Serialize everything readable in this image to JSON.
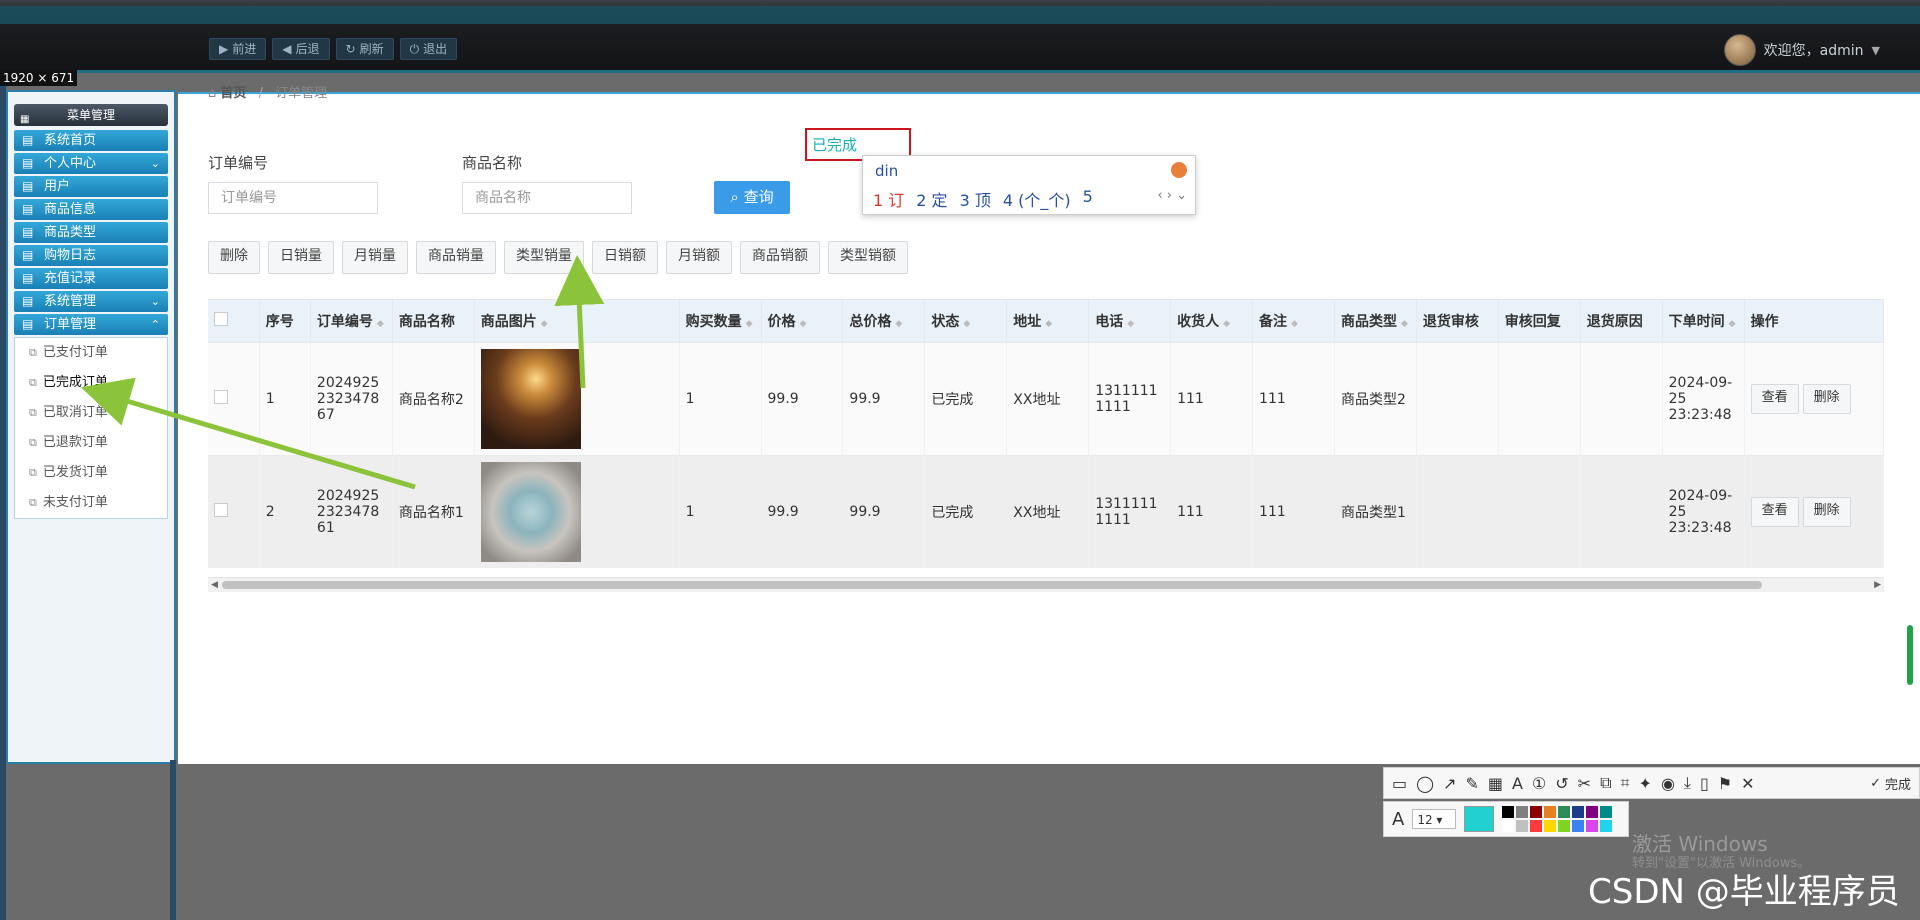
{
  "topbar": {
    "nav": [
      "前进",
      "后退",
      "刷新",
      "退出"
    ],
    "welcome": "欢迎您，admin"
  },
  "dim_label": "1920 × 671",
  "sidebar": {
    "header": "菜单管理",
    "items": [
      "系统首页",
      "个人中心",
      "用户",
      "商品信息",
      "商品类型",
      "购物日志",
      "充值记录",
      "系统管理",
      "订单管理"
    ],
    "sub_items": [
      "已支付订单",
      "已完成订单",
      "已取消订单",
      "已退款订单",
      "已发货订单",
      "未支付订单"
    ],
    "active_sub": "已完成订单"
  },
  "breadcrumb": {
    "home": "首页",
    "current": "订单管理"
  },
  "search": {
    "order_label": "订单编号",
    "order_placeholder": "订单编号",
    "product_label": "商品名称",
    "product_placeholder": "商品名称",
    "query_button": "查询"
  },
  "toolbar": [
    "删除",
    "日销量",
    "月销量",
    "商品销量",
    "类型销量",
    "日销额",
    "月销额",
    "商品销额",
    "类型销额"
  ],
  "highlight_text": "已完成",
  "ime": {
    "input": "din",
    "candidates": [
      "1 订",
      "2 定",
      "3 顶",
      "4 (个_个)",
      "5"
    ]
  },
  "table": {
    "headers": [
      "序号",
      "订单编号",
      "商品名称",
      "商品图片",
      "购买数量",
      "价格",
      "总价格",
      "状态",
      "地址",
      "电话",
      "收货人",
      "备注",
      "商品类型",
      "退货审核",
      "审核回复",
      "退货原因",
      "下单时间",
      "操作"
    ],
    "rows": [
      {
        "idx": "1",
        "order_no": "2024925232347867",
        "name": "商品名称2",
        "image": "lamp",
        "qty": "1",
        "price": "99.9",
        "total": "99.9",
        "status": "已完成",
        "address": "XX地址",
        "phone": "13111111111",
        "receiver": "111",
        "remark": "111",
        "type": "商品类型2",
        "return_review": "",
        "review_reply": "",
        "return_reason": "",
        "time": "2024-09-25 23:23:48"
      },
      {
        "idx": "2",
        "order_no": "2024925232347861",
        "name": "商品名称1",
        "image": "pillow",
        "qty": "1",
        "price": "99.9",
        "total": "99.9",
        "status": "已完成",
        "address": "XX地址",
        "phone": "13111111111",
        "receiver": "111",
        "remark": "111",
        "type": "商品类型1",
        "return_review": "",
        "review_reply": "",
        "return_reason": "",
        "time": "2024-09-25 23:23:48"
      }
    ],
    "actions": [
      "查看",
      "删除"
    ]
  },
  "snap_toolbar": {
    "done": "完成",
    "font_size": "12"
  },
  "watermarks": {
    "activate": "激活 Windows",
    "activate_sub": "转到\"设置\"以激活 Windows。",
    "csdn": "CSDN @毕业程序员"
  }
}
